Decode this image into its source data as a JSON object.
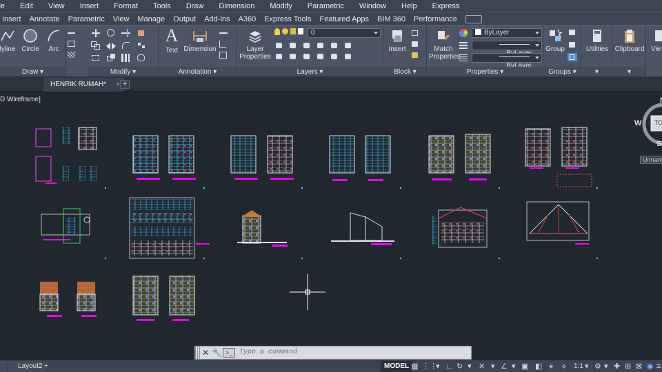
{
  "menu": [
    "ile",
    "Edit",
    "View",
    "Insert",
    "Format",
    "Tools",
    "Draw",
    "Dimension",
    "Modify",
    "Parametric",
    "Window",
    "Help",
    "Express"
  ],
  "ribbon_tabs": [
    "Insert",
    "Annotate",
    "Parametric",
    "View",
    "Manage",
    "Output",
    "Add-ins",
    "A360",
    "Express Tools",
    "Featured Apps",
    "BIM 360",
    "Performance"
  ],
  "ribbon": {
    "draw": {
      "label": "Draw",
      "polyline": "lyline",
      "circle": "Circle",
      "arc": "Arc"
    },
    "modify": {
      "label": "Modify"
    },
    "annotation": {
      "label": "Annotation",
      "text": "Text",
      "dimension": "Dimension"
    },
    "layers": {
      "label": "Layers",
      "layer_properties_1": "Layer",
      "layer_properties_2": "Properties",
      "current_layer": "0"
    },
    "block": {
      "label": "Block",
      "insert": "Insert"
    },
    "properties": {
      "label": "Properties",
      "match_1": "Match",
      "match_2": "Properties",
      "color": "ByLayer",
      "linetype": "ByLayer",
      "lineweight": "ByLayer"
    },
    "groups": {
      "label": "Groups",
      "group": "Group"
    },
    "utilities": {
      "label": "Utilities"
    },
    "clipboard": {
      "label": "Clipboard"
    },
    "view": {
      "label": "Vie"
    }
  },
  "document_tab": "HENRIK RUMAH*",
  "viewport_label": "D Wireframe]",
  "viewcube": {
    "north": "N",
    "west": "W",
    "south": "S",
    "top_face": "TO",
    "ucs": "Unname"
  },
  "command": {
    "placeholder": "Type a command"
  },
  "layout_tabs": [
    "Layout2"
  ],
  "status": {
    "model": "MODEL",
    "scale": "1:1"
  },
  "colors": {
    "ribbon_bg": "#4b5566",
    "menu_bg": "#3b4453",
    "canvas_bg": "#212830",
    "magenta": "#ff00ff",
    "cyan": "#00ffff"
  }
}
